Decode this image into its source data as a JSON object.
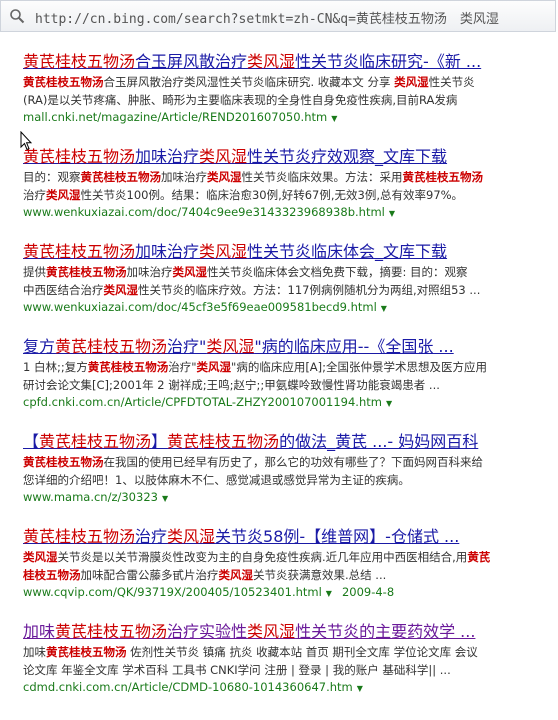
{
  "address_bar": {
    "url": "http://cn.bing.com/search?setmkt=zh-CN&q=黄芪桂枝五物汤　类风湿"
  },
  "results": [
    {
      "title": [
        [
          "黄芪桂枝五物汤",
          1
        ],
        [
          "合玉屏风散治疗",
          0
        ],
        [
          "类风湿",
          1
        ],
        [
          "性关节炎临床研究-《新 ...",
          0
        ]
      ],
      "desc": [
        [
          [
            "黄芪桂枝五物汤",
            1
          ],
          [
            "合玉屏风散治疗类风湿性关节炎临床研究. 收藏本文 分享 ",
            0
          ],
          [
            "类风湿",
            1
          ],
          [
            "性关节炎",
            0
          ]
        ],
        [
          [
            "(RA)是以关节疼痛、肿胀、畸形为主要临床表现的全身性自身免疫性疾病,目前RA发病",
            0
          ]
        ]
      ],
      "url": "mall.cnki.net/magazine/Article/REND201607050.htm",
      "date": "",
      "visited": false
    },
    {
      "title": [
        [
          "黄芪桂枝五物汤",
          1
        ],
        [
          "加味治疗",
          0
        ],
        [
          "类风湿",
          1
        ],
        [
          "性关节炎疗效观察_文库下载",
          0
        ]
      ],
      "desc": [
        [
          [
            "目的：观察",
            0
          ],
          [
            "黄芪桂枝五物汤",
            1
          ],
          [
            "加味治疗",
            0
          ],
          [
            "类风湿",
            1
          ],
          [
            "性关节炎临床效果。方法：采用",
            0
          ],
          [
            "黄芪桂枝五物汤",
            1
          ]
        ],
        [
          [
            "治疗",
            0
          ],
          [
            "类风湿",
            1
          ],
          [
            "性关节炎100例。结果：临床治愈30例,好转67例,无效3例,总有效率97%。",
            0
          ]
        ]
      ],
      "url": "www.wenkuxiazai.com/doc/7404c9ee9e3143323968938b.html",
      "date": "",
      "visited": false
    },
    {
      "title": [
        [
          "黄芪桂枝五物汤",
          1
        ],
        [
          "加味治疗",
          0
        ],
        [
          "类风湿",
          1
        ],
        [
          "性关节炎临床体会_文库下载",
          0
        ]
      ],
      "desc": [
        [
          [
            "提供",
            0
          ],
          [
            "黄芪桂枝五物汤",
            1
          ],
          [
            "加味治疗",
            0
          ],
          [
            "类风湿",
            1
          ],
          [
            "性关节炎临床体会文档免费下载，摘要: 目的：观察",
            0
          ]
        ],
        [
          [
            "中西医结合治疗",
            0
          ],
          [
            "类风湿",
            1
          ],
          [
            "性关节炎的临床疗效。方法：117例病例随机分为两组,对照组53 ...",
            0
          ]
        ]
      ],
      "url": "www.wenkuxiazai.com/doc/45cf3e5f69eae009581becd9.html",
      "date": "",
      "visited": false
    },
    {
      "title": [
        [
          "复方",
          0
        ],
        [
          "黄芪桂枝五物汤",
          1
        ],
        [
          "治疗\"",
          0
        ],
        [
          "类风湿",
          1
        ],
        [
          "\"病的临床应用--《全国张 ...",
          0
        ]
      ],
      "desc": [
        [
          [
            "1 白林;;复方",
            0
          ],
          [
            "黄芪桂枝五物汤",
            1
          ],
          [
            "治疗\"",
            0
          ],
          [
            "类风湿",
            1
          ],
          [
            "\"病的临床应用[A];全国张仲景学术思想及医方应用",
            0
          ]
        ],
        [
          [
            "研讨会论文集[C];2001年 2 谢祥成;王鸣;赵宁;;甲氨蝶呤致慢性肾功能衰竭患者 ...",
            0
          ]
        ]
      ],
      "url": "cpfd.cnki.com.cn/Article/CPFDTOTAL-ZHZY200107001194.htm",
      "date": "",
      "visited": false
    },
    {
      "title": [
        [
          "【",
          0
        ],
        [
          "黄芪桂枝五物汤",
          1
        ],
        [
          "】",
          0
        ],
        [
          "黄芪桂枝五物汤",
          1
        ],
        [
          "的做法_黄芪 ...- 妈妈网百科",
          0
        ]
      ],
      "desc": [
        [
          [
            "黄芪桂枝五物汤",
            1
          ],
          [
            "在我国的使用已经早有历史了，那么它的功效有哪些了？下面妈网百科来给",
            0
          ]
        ],
        [
          [
            "您详细的介绍吧！1、以肢体麻木不仁、感觉减退或感觉异常为主证的疾病。",
            0
          ]
        ]
      ],
      "url": "www.mama.cn/z/30323",
      "date": "",
      "visited": false
    },
    {
      "title": [
        [
          "黄芪桂枝五物汤",
          1
        ],
        [
          "治疗",
          0
        ],
        [
          "类风湿",
          1
        ],
        [
          "关节炎58例-【维普网】-仓储式 ...",
          0
        ]
      ],
      "desc": [
        [
          [
            "类风湿",
            1
          ],
          [
            "关节炎是以关节滑膜炎性改变为主的自身免疫性疾病.近几年应用中西医相结合,用",
            0
          ],
          [
            "黄芪",
            1
          ]
        ],
        [
          [
            "桂枝五物汤",
            1
          ],
          [
            "加味配合雷公藤多甙片治疗",
            0
          ],
          [
            "类风湿",
            1
          ],
          [
            "关节炎获满意效果.总结 ...",
            0
          ]
        ]
      ],
      "url": "www.cqvip.com/QK/93719X/200405/10523401.html",
      "date": "2009-4-8",
      "visited": false
    },
    {
      "title": [
        [
          "加味",
          0
        ],
        [
          "黄芪桂枝五物汤",
          1
        ],
        [
          "治疗实验性",
          0
        ],
        [
          "类风湿",
          1
        ],
        [
          "性关节炎的主要药效学 ...",
          0
        ]
      ],
      "desc": [
        [
          [
            "加味",
            0
          ],
          [
            "黄芪桂枝五物汤",
            1
          ],
          [
            " 佐剂性关节炎 镇痛 抗炎 收藏本站 首页 期刊全文库 学位论文库 会议",
            0
          ]
        ],
        [
          [
            "论文库 年鉴全文库 学术百科 工具书 CNKI学问 注册 | 登录 | 我的账户 基础科学|| ...",
            0
          ]
        ]
      ],
      "url": "cdmd.cnki.com.cn/Article/CDMD-10680-1014360647.htm",
      "date": "",
      "visited": true
    }
  ],
  "colors": {
    "link": "#1a1aa6",
    "visited": "#6a1a9a",
    "highlight": "#cc0000",
    "url": "#1a7a1a"
  }
}
